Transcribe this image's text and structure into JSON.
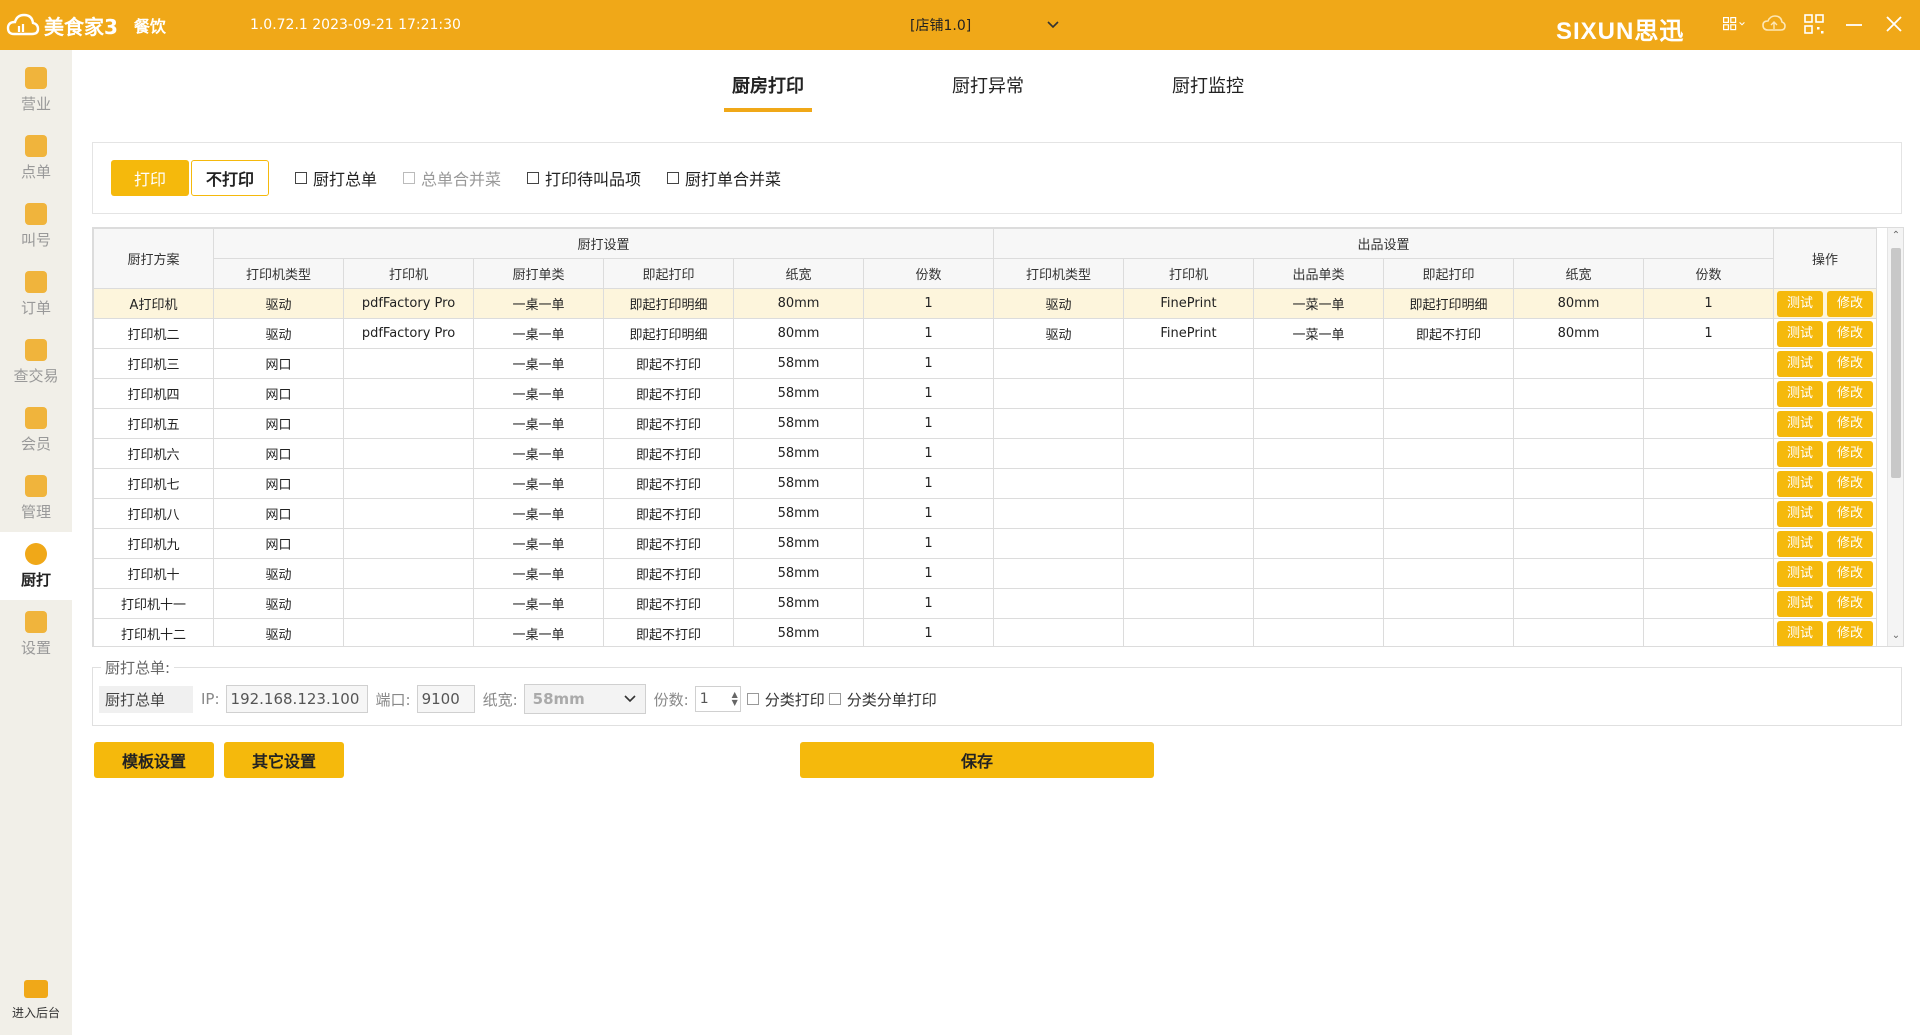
{
  "titlebar": {
    "app_name": "美食家3",
    "module": "餐饮",
    "version": "1.0.72.1 2023-09-21 17:21:30",
    "store": "[店铺1.0]",
    "brand": "SIXUN思迅"
  },
  "sidebar": {
    "items": [
      {
        "label": "营业",
        "icon": "chart-icon"
      },
      {
        "label": "点单",
        "icon": "hand-icon"
      },
      {
        "label": "叫号",
        "icon": "ticket-icon"
      },
      {
        "label": "订单",
        "icon": "document-icon"
      },
      {
        "label": "查交易",
        "icon": "search-icon"
      },
      {
        "label": "会员",
        "icon": "diamond-icon"
      },
      {
        "label": "管理",
        "icon": "grid-icon"
      },
      {
        "label": "厨打",
        "icon": "menu-icon"
      },
      {
        "label": "设置",
        "icon": "gear-icon"
      }
    ],
    "active_index": 7,
    "bottom_label": "进入后台"
  },
  "tabs": [
    {
      "label": "厨房打印",
      "active": true
    },
    {
      "label": "厨打异常",
      "active": false
    },
    {
      "label": "厨打监控",
      "active": false
    }
  ],
  "toolbar": {
    "print_label": "打印",
    "noprint_label": "不打印",
    "checkboxes": [
      {
        "label": "厨打总单",
        "checked": false,
        "disabled": false
      },
      {
        "label": "总单合并菜",
        "checked": false,
        "disabled": true
      },
      {
        "label": "打印待叫品项",
        "checked": false,
        "disabled": false
      },
      {
        "label": "厨打单合并菜",
        "checked": false,
        "disabled": false
      }
    ]
  },
  "table": {
    "col_plan": "厨打方案",
    "group_kitchen": "厨打设置",
    "group_output": "出品设置",
    "col_op": "操作",
    "kitchen_cols": [
      "打印机类型",
      "打印机",
      "厨打单类",
      "即起打印",
      "纸宽",
      "份数"
    ],
    "output_cols": [
      "打印机类型",
      "打印机",
      "出品单类",
      "即起打印",
      "纸宽",
      "份数"
    ],
    "btn_test": "测试",
    "btn_edit": "修改",
    "rows": [
      [
        "A打印机",
        "驱动",
        "pdfFactory Pro",
        "一桌一单",
        "即起打印明细",
        "80mm",
        "1",
        "驱动",
        "FinePrint",
        "一菜一单",
        "即起打印明细",
        "80mm",
        "1"
      ],
      [
        "打印机二",
        "驱动",
        "pdfFactory Pro",
        "一桌一单",
        "即起打印明细",
        "80mm",
        "1",
        "驱动",
        "FinePrint",
        "一菜一单",
        "即起不打印",
        "80mm",
        "1"
      ],
      [
        "打印机三",
        "网口",
        "",
        "一桌一单",
        "即起不打印",
        "58mm",
        "1",
        "",
        "",
        "",
        "",
        "",
        ""
      ],
      [
        "打印机四",
        "网口",
        "",
        "一桌一单",
        "即起不打印",
        "58mm",
        "1",
        "",
        "",
        "",
        "",
        "",
        ""
      ],
      [
        "打印机五",
        "网口",
        "",
        "一桌一单",
        "即起不打印",
        "58mm",
        "1",
        "",
        "",
        "",
        "",
        "",
        ""
      ],
      [
        "打印机六",
        "网口",
        "",
        "一桌一单",
        "即起不打印",
        "58mm",
        "1",
        "",
        "",
        "",
        "",
        "",
        ""
      ],
      [
        "打印机七",
        "网口",
        "",
        "一桌一单",
        "即起不打印",
        "58mm",
        "1",
        "",
        "",
        "",
        "",
        "",
        ""
      ],
      [
        "打印机八",
        "网口",
        "",
        "一桌一单",
        "即起不打印",
        "58mm",
        "1",
        "",
        "",
        "",
        "",
        "",
        ""
      ],
      [
        "打印机九",
        "网口",
        "",
        "一桌一单",
        "即起不打印",
        "58mm",
        "1",
        "",
        "",
        "",
        "",
        "",
        ""
      ],
      [
        "打印机十",
        "驱动",
        "",
        "一桌一单",
        "即起不打印",
        "58mm",
        "1",
        "",
        "",
        "",
        "",
        "",
        ""
      ],
      [
        "打印机十一",
        "驱动",
        "",
        "一桌一单",
        "即起不打印",
        "58mm",
        "1",
        "",
        "",
        "",
        "",
        "",
        ""
      ],
      [
        "打印机十二",
        "驱动",
        "",
        "一桌一单",
        "即起不打印",
        "58mm",
        "1",
        "",
        "",
        "",
        "",
        "",
        ""
      ]
    ]
  },
  "summary": {
    "legend": "厨打总单:",
    "name": "厨打总单",
    "ip_label": "IP:",
    "ip_value": "192.168.123.100",
    "port_label": "端口:",
    "port_value": "9100",
    "paper_label": "纸宽:",
    "paper_value": "58mm",
    "copies_label": "份数:",
    "copies_value": "1",
    "cat_print": "分类打印",
    "cat_split_print": "分类分单打印"
  },
  "buttons": {
    "template": "模板设置",
    "other": "其它设置",
    "save": "保存"
  },
  "colors": {
    "accent": "#f0a818",
    "button": "#f5b90c",
    "highlight_row": "#fdf5dc"
  }
}
